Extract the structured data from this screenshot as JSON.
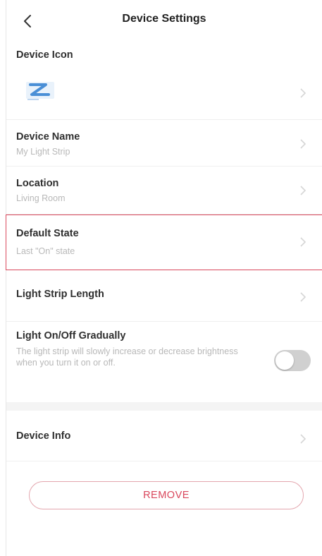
{
  "header": {
    "title": "Device Settings",
    "back_icon": "chevron-left-icon"
  },
  "rows": {
    "device_icon": {
      "label": "Device Icon",
      "icon": "light-strip-z-icon"
    },
    "device_name": {
      "label": "Device Name",
      "value": "My Light Strip"
    },
    "location": {
      "label": "Location",
      "value": "Living Room"
    },
    "default_state": {
      "label": "Default State",
      "value": "Last \"On\" state",
      "highlight_color": "#d9475c"
    },
    "strip_length": {
      "label": "Light Strip Length"
    },
    "gradual": {
      "label": "Light On/Off Gradually",
      "description": "The light strip will slowly increase or decrease brightness when you turn it on or off.",
      "toggle_on": false
    },
    "device_info": {
      "label": "Device Info"
    }
  },
  "remove": {
    "label": "REMOVE",
    "color": "#d9475c"
  },
  "chevron_icon": "chevron-right-icon"
}
